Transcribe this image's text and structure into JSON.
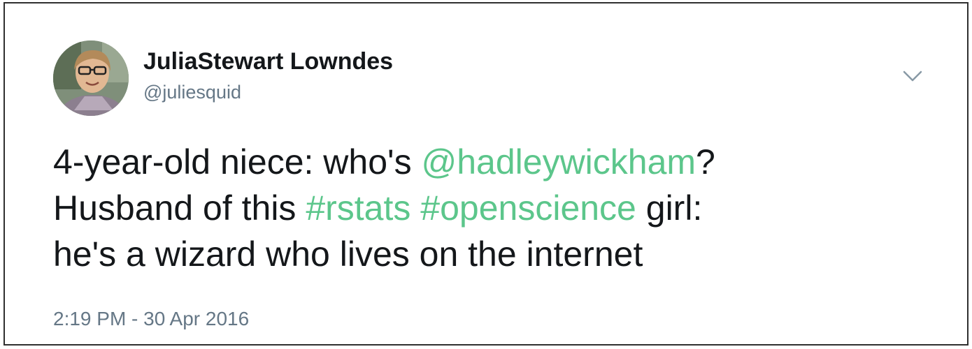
{
  "author": {
    "display_name": "JuliaStewart Lowndes",
    "handle": "@juliesquid",
    "avatar_icon": "profile-photo"
  },
  "menu_icon": "chevron-down-icon",
  "tweet": {
    "line1": {
      "text_a": "4-year-old niece: who's ",
      "mention": "@hadleywickham",
      "text_b": "?"
    },
    "line2": {
      "text_a": "Husband of this ",
      "hashtag1": "#rstats",
      "space": " ",
      "hashtag2": "#openscience",
      "text_b": " girl:"
    },
    "line3": {
      "text_a": "he's a wizard who lives on the internet"
    }
  },
  "timestamp": "2:19 PM - 30 Apr 2016",
  "colors": {
    "link": "#5cc68b",
    "text": "#14171a",
    "secondary": "#657786",
    "border": "#2f2f2f"
  }
}
